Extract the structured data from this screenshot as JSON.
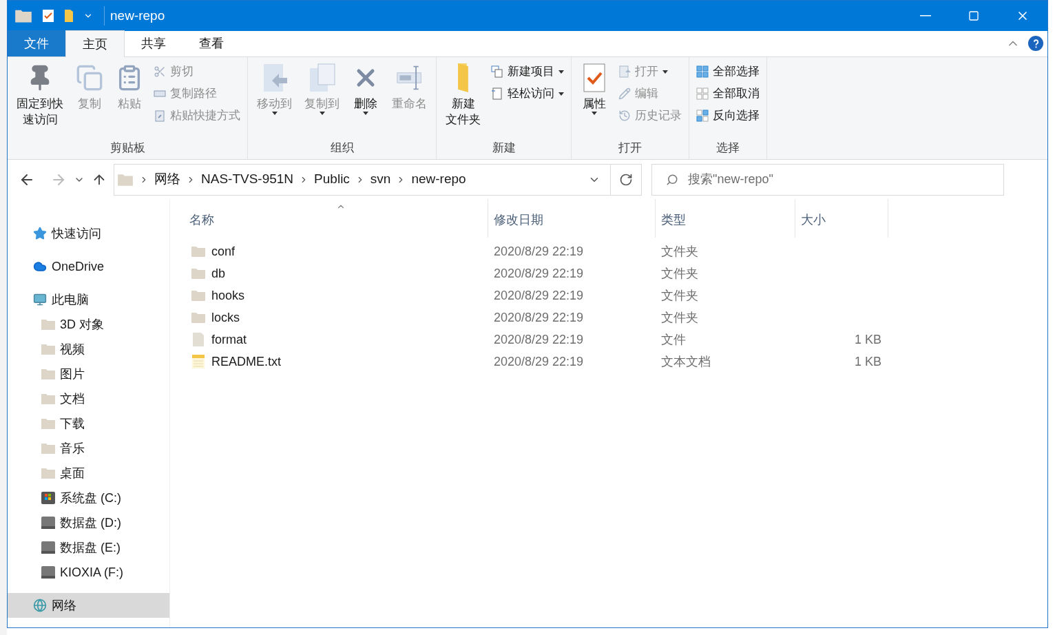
{
  "window": {
    "title": "new-repo"
  },
  "ribbon_tabs": [
    {
      "label": "文件",
      "kind": "file",
      "selected": false
    },
    {
      "label": "主页",
      "kind": "tab",
      "selected": true
    },
    {
      "label": "共享",
      "kind": "tab",
      "selected": false
    },
    {
      "label": "查看",
      "kind": "tab",
      "selected": false
    }
  ],
  "ribbon_groups": [
    {
      "label": "剪贴板",
      "columns": [
        [
          {
            "kind": "large",
            "lines": [
              "固定到快",
              "速访问"
            ],
            "disabled": false,
            "dropdown": false
          }
        ],
        [
          {
            "kind": "large",
            "lines": [
              "复制"
            ],
            "disabled": true,
            "dropdown": false
          }
        ],
        [
          {
            "kind": "large",
            "lines": [
              "粘贴"
            ],
            "disabled": true,
            "dropdown": false
          }
        ],
        [
          {
            "kind": "small",
            "label": "剪切",
            "disabled": true,
            "dropdown": false
          },
          {
            "kind": "small",
            "label": "复制路径",
            "disabled": true,
            "dropdown": false
          },
          {
            "kind": "small",
            "label": "粘贴快捷方式",
            "disabled": true,
            "dropdown": false
          }
        ]
      ]
    },
    {
      "label": "组织",
      "columns": [
        [
          {
            "kind": "large",
            "lines": [
              "移动到"
            ],
            "disabled": true,
            "dropdown": true
          }
        ],
        [
          {
            "kind": "large",
            "lines": [
              "复制到"
            ],
            "disabled": true,
            "dropdown": true
          }
        ],
        [
          {
            "kind": "large",
            "lines": [
              "删除"
            ],
            "disabled": false,
            "dropdown": true
          }
        ],
        [
          {
            "kind": "large",
            "lines": [
              "重命名"
            ],
            "disabled": true,
            "dropdown": false
          }
        ]
      ]
    },
    {
      "label": "新建",
      "columns": [
        [
          {
            "kind": "large",
            "lines": [
              "新建",
              "文件夹"
            ],
            "disabled": false,
            "dropdown": false
          }
        ],
        [
          {
            "kind": "small",
            "label": "新建项目",
            "disabled": false,
            "dropdown": true
          },
          {
            "kind": "small",
            "label": "轻松访问",
            "disabled": false,
            "dropdown": true
          }
        ]
      ]
    },
    {
      "label": "打开",
      "columns": [
        [
          {
            "kind": "large",
            "lines": [
              "属性"
            ],
            "disabled": false,
            "dropdown": true
          }
        ],
        [
          {
            "kind": "small",
            "label": "打开",
            "disabled": true,
            "dropdown": true
          },
          {
            "kind": "small",
            "label": "编辑",
            "disabled": true,
            "dropdown": false
          },
          {
            "kind": "small",
            "label": "历史记录",
            "disabled": true,
            "dropdown": false
          }
        ]
      ]
    },
    {
      "label": "选择",
      "columns": [
        [
          {
            "kind": "small",
            "label": "全部选择",
            "disabled": false,
            "dropdown": false
          },
          {
            "kind": "small",
            "label": "全部取消",
            "disabled": false,
            "dropdown": false
          },
          {
            "kind": "small",
            "label": "反向选择",
            "disabled": false,
            "dropdown": false
          }
        ]
      ]
    }
  ],
  "address_bar": {
    "breadcrumbs": [
      "网络",
      "NAS-TVS-951N",
      "Public",
      "svn",
      "new-repo"
    ]
  },
  "search": {
    "placeholder": "搜索\"new-repo\""
  },
  "sidebar": {
    "items": [
      {
        "label": "快速访问",
        "selected": false
      },
      {
        "label": "OneDrive",
        "selected": false
      },
      {
        "label": "此电脑",
        "selected": false,
        "children": [
          {
            "label": "3D 对象",
            "selected": false
          },
          {
            "label": "视频",
            "selected": false
          },
          {
            "label": "图片",
            "selected": false
          },
          {
            "label": "文档",
            "selected": false
          },
          {
            "label": "下载",
            "selected": false
          },
          {
            "label": "音乐",
            "selected": false
          },
          {
            "label": "桌面",
            "selected": false
          },
          {
            "label": "系统盘 (C:)",
            "selected": false
          },
          {
            "label": "数据盘 (D:)",
            "selected": false
          },
          {
            "label": "数据盘 (E:)",
            "selected": false
          },
          {
            "label": "KIOXIA (F:)",
            "selected": false
          }
        ]
      },
      {
        "label": "网络",
        "selected": true
      }
    ]
  },
  "table": {
    "columns": [
      {
        "label": "名称",
        "sorted": true
      },
      {
        "label": "修改日期",
        "sorted": false
      },
      {
        "label": "类型",
        "sorted": false
      },
      {
        "label": "大小",
        "sorted": false
      }
    ],
    "rows": [
      {
        "kind": "folder",
        "name": "conf",
        "modified": "2020/8/29 22:19",
        "type": "文件夹"
      },
      {
        "kind": "folder",
        "name": "db",
        "modified": "2020/8/29 22:19",
        "type": "文件夹"
      },
      {
        "kind": "folder",
        "name": "hooks",
        "modified": "2020/8/29 22:19",
        "type": "文件夹"
      },
      {
        "kind": "folder",
        "name": "locks",
        "modified": "2020/8/29 22:19",
        "type": "文件夹"
      },
      {
        "kind": "file",
        "name": "format",
        "modified": "2020/8/29 22:19",
        "type": "文件",
        "size": "1 KB"
      },
      {
        "kind": "text",
        "name": "README.txt",
        "modified": "2020/8/29 22:19",
        "type": "文本文档",
        "size": "1 KB"
      }
    ]
  }
}
